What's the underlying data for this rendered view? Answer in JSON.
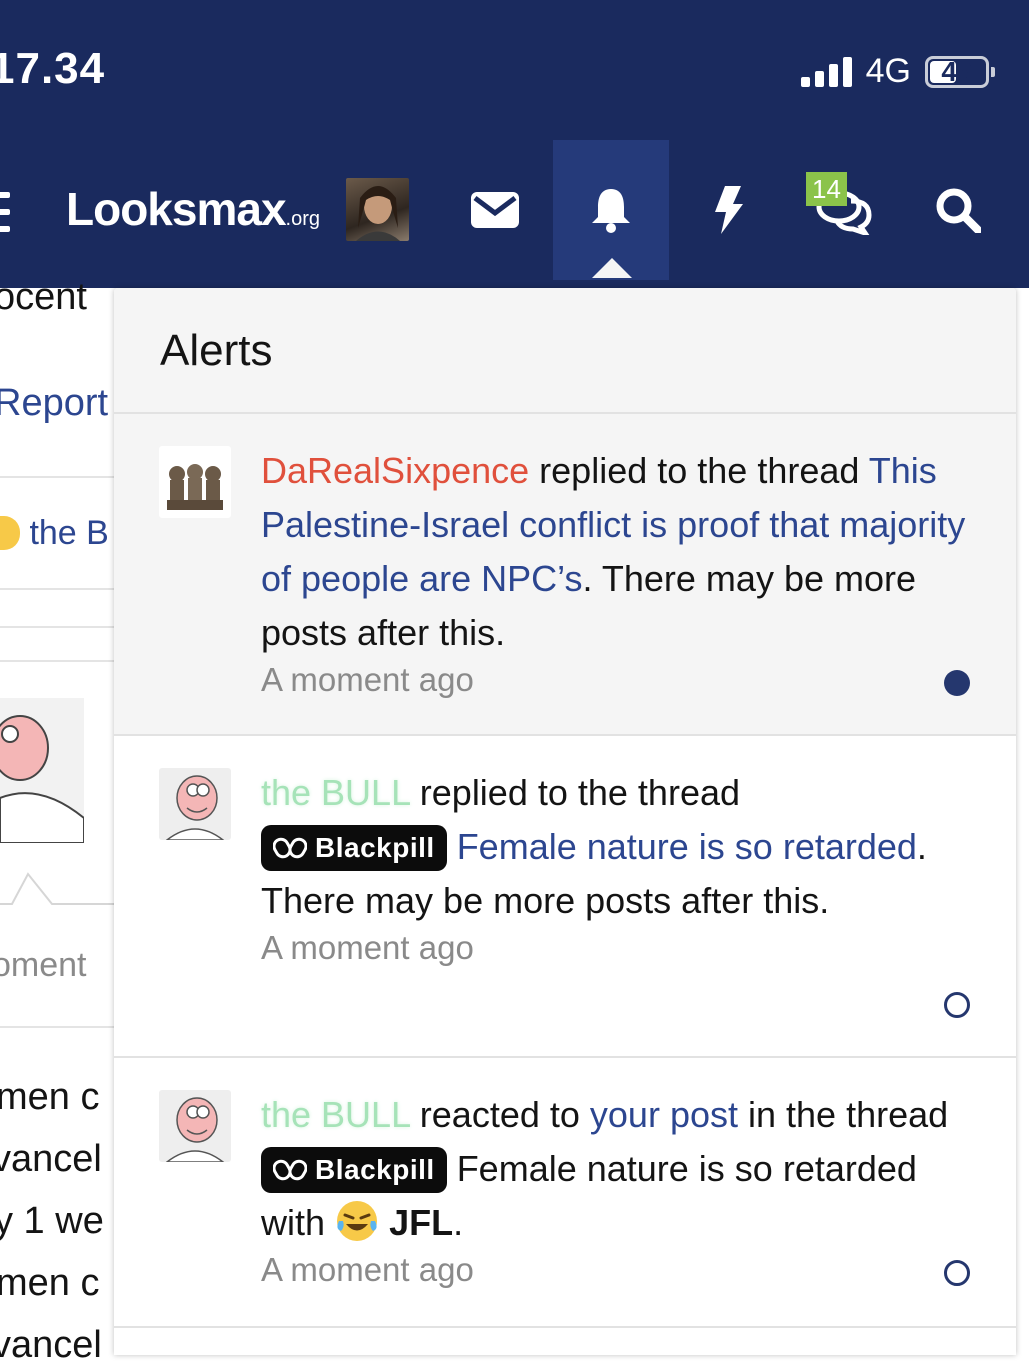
{
  "status_bar": {
    "time": "17.34",
    "network": "4G",
    "battery": "49",
    "battery_level": 0.49
  },
  "nav": {
    "logo_main": "Looksmax",
    "logo_suffix": ".org",
    "conversations_badge": "14",
    "icons": [
      "menu-icon",
      "avatar",
      "envelope-icon",
      "bell-icon",
      "bolt-icon",
      "chat-icon",
      "search-icon"
    ]
  },
  "background_page": {
    "fragments": [
      "ocent",
      "Report",
      "the B",
      "oment",
      "men c",
      "vancel",
      "y 1 we",
      "men c",
      "vancel"
    ]
  },
  "alerts_panel": {
    "title": "Alerts",
    "items": [
      {
        "user": "DaRealSixpence",
        "action": "replied to the thread",
        "thread": "This Palestine-Israel conflict is proof that majority of people are NPC’s",
        "suffix": ". There may be more posts after this.",
        "time": "A moment ago",
        "unread": true
      },
      {
        "user": "the BULL",
        "action": "replied to the thread",
        "prefix": "Blackpill",
        "thread": "Female nature is so retarded",
        "suffix": ". There may be more posts after this.",
        "time": "A moment ago",
        "unread": false
      },
      {
        "user": "the BULL",
        "action": "reacted to",
        "post_link": "your post",
        "action2": "in the thread",
        "prefix": "Blackpill",
        "thread": "Female nature is so retarded with",
        "reaction": "JFL",
        "suffix": ".",
        "time": "A moment ago",
        "unread": false
      }
    ]
  },
  "colors": {
    "header_bg": "#1a2a5e",
    "active_tab": "#253a7a",
    "link": "#2c4690",
    "username_red": "#e0503c",
    "username_green": "#a6e3b8",
    "badge_green": "#8bc34a"
  }
}
